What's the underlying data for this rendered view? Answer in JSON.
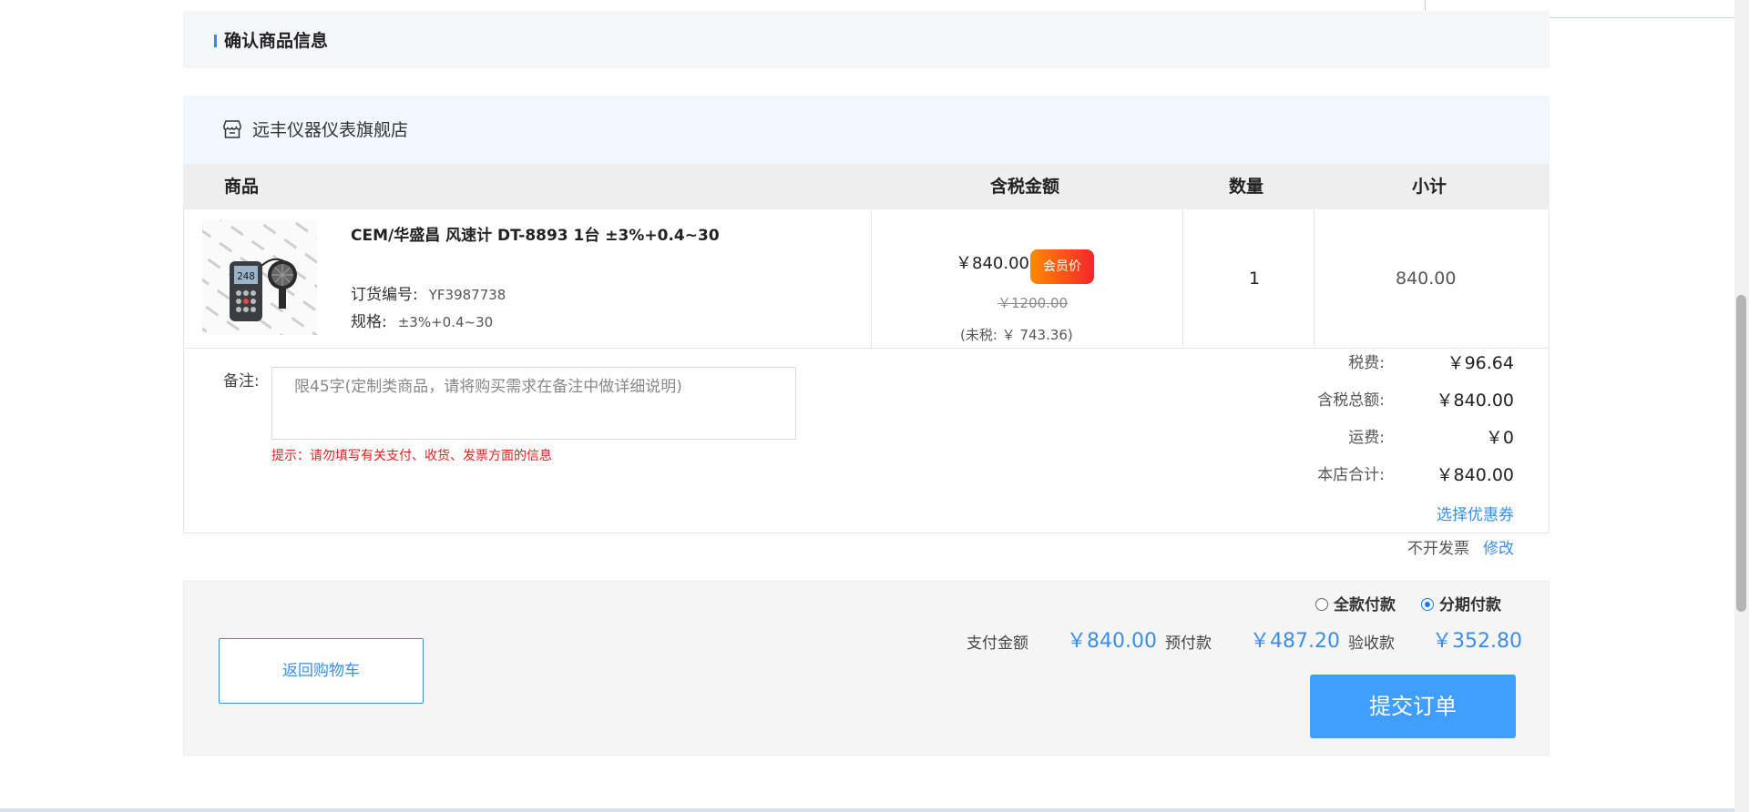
{
  "section": {
    "title": "确认商品信息"
  },
  "shop": {
    "name": "远丰仪器仪表旗舰店",
    "icon": "store-icon"
  },
  "table": {
    "headers": {
      "product": "商品",
      "price": "含税金额",
      "quantity": "数量",
      "subtotal": "小计"
    }
  },
  "product": {
    "name": "CEM/华盛昌 风速计 DT-8893 1台 ±3%+0.4~30",
    "order_no_label": "订货编号:",
    "order_no": "YF3987738",
    "spec_label": "规格:",
    "spec": "±3%+0.4~30",
    "price": "￥840.00",
    "member_badge": "会员价",
    "original_price": "￥1200.00",
    "pre_tax": "(未税:  ￥ 743.36)",
    "quantity": "1",
    "subtotal": "840.00",
    "image_alt": "anemometer-image"
  },
  "remark": {
    "label": "备注:",
    "placeholder": "限45字(定制类商品，请将购买需求在备注中做详细说明)",
    "tip": "提示：请勿填写有关支付、收货、发票方面的信息"
  },
  "summary": {
    "tax_label": "税费:",
    "tax": "￥96.64",
    "total_label": "含税总额:",
    "total": "￥840.00",
    "shipping_label": "运费:",
    "shipping": "￥0",
    "store_total_label": "本店合计:",
    "store_total": "￥840.00",
    "coupon_link": "选择优惠券"
  },
  "invoice": {
    "status": "不开发票",
    "edit": "修改"
  },
  "payment": {
    "options": [
      {
        "label": "全款付款",
        "selected": false
      },
      {
        "label": "分期付款",
        "selected": true
      }
    ],
    "pay_amount_label": "支付金额",
    "pay_amount": "￥840.00",
    "prepay_label": "预付款",
    "prepay": "￥487.20",
    "acceptance_label": "验收款",
    "acceptance": "￥352.80",
    "back_button": "返回购物车",
    "submit_button": "提交订单"
  },
  "colors": {
    "accent": "#409eff",
    "link": "#3a8ee6",
    "warning": "#e02020",
    "badge_from": "#ff8a00",
    "badge_to": "#f4262b"
  }
}
